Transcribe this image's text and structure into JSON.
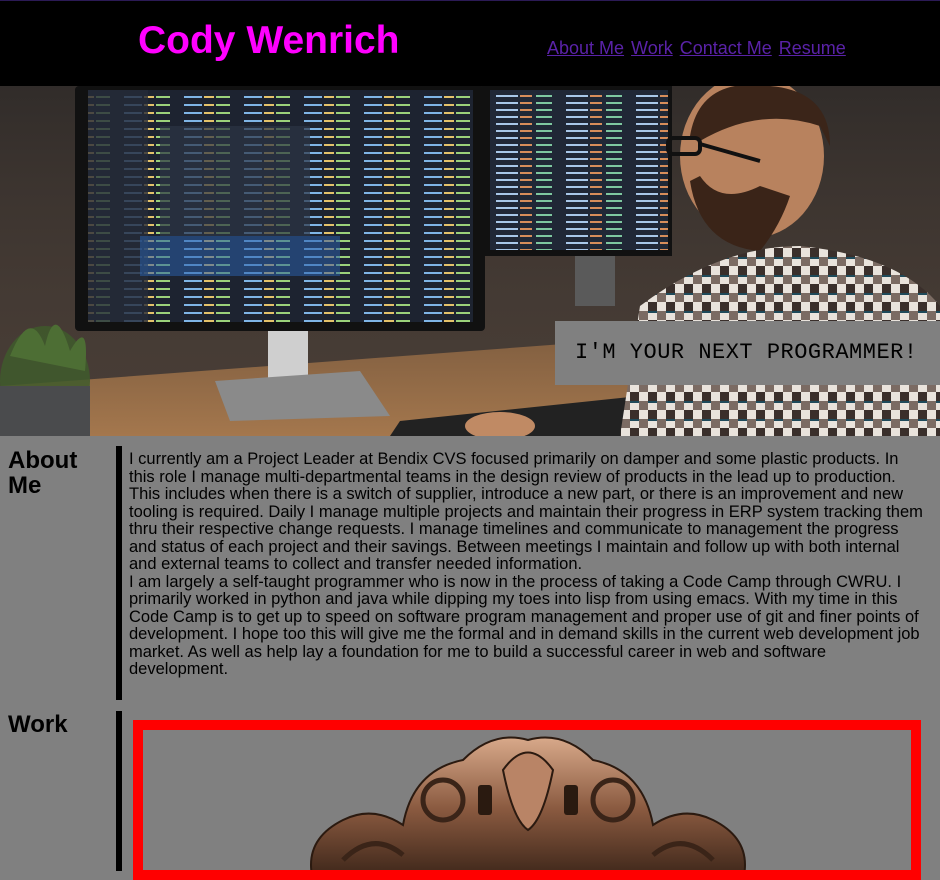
{
  "header": {
    "brand": "Cody Wenrich",
    "nav": [
      {
        "label": "About Me"
      },
      {
        "label": "Work"
      },
      {
        "label": "Contact Me"
      },
      {
        "label": "Resume"
      }
    ]
  },
  "hero": {
    "tagline": "I'M YOUR NEXT PROGRAMMER!"
  },
  "about": {
    "title": "About Me",
    "paragraphs": [
      "I currently am a Project Leader at Bendix CVS focused primarily on damper and some plastic products. In this role I manage multi-departmental teams in the design review of products in the lead up to production. This includes when there is a switch of supplier, introduce a new part, or there is an improvement and new tooling is required. Daily I manage multiple projects and maintain their progress in ERP system tracking them thru their respective change requests. I manage timelines and communicate to management the progress and status of each project and their savings. Between meetings I maintain and follow up with both internal and external teams to collect and transfer needed information.",
      "I am largely a self-taught programmer who is now in the process of taking a Code Camp through CWRU. I primarily worked in python and java while dipping my toes into lisp from using emacs. With my time in this Code Camp is to get up to speed on software program management and proper use of git and finer points of development. I hope too this will give me the formal and in demand skills in the current web development job market. As well as help lay a foundation for me to build a successful career in web and software development."
    ]
  },
  "work": {
    "title": "Work"
  },
  "colors": {
    "brand": "#ff00ff",
    "nav_link": "#5a22a8",
    "background": "#808080",
    "frame": "#ff0000"
  }
}
